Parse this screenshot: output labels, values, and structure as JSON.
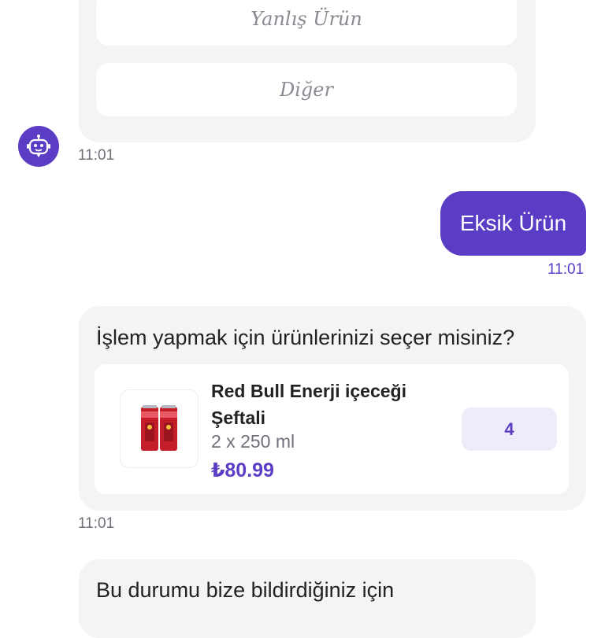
{
  "options": [
    {
      "label": "Yanlış Ürün"
    },
    {
      "label": "Diğer"
    }
  ],
  "avatar_icon": "bot-icon",
  "times": {
    "bot_options": "11:01",
    "user_reply": "11:01",
    "bot_product": "11:01"
  },
  "user_reply": "Eksik Ürün",
  "product_prompt": "İşlem yapmak için ürünlerinizi seçer misiniz?",
  "product": {
    "name": "Red Bull Enerji içeceği Şeftali",
    "size": "2 x 250 ml",
    "price": "₺80.99",
    "quantity": "4"
  },
  "thanks_text": "Bu durumu bize bildirdiğiniz için",
  "colors": {
    "accent": "#5b3cc4",
    "bubble_bg": "#f4f4f5",
    "qty_bg": "#efecf9"
  }
}
